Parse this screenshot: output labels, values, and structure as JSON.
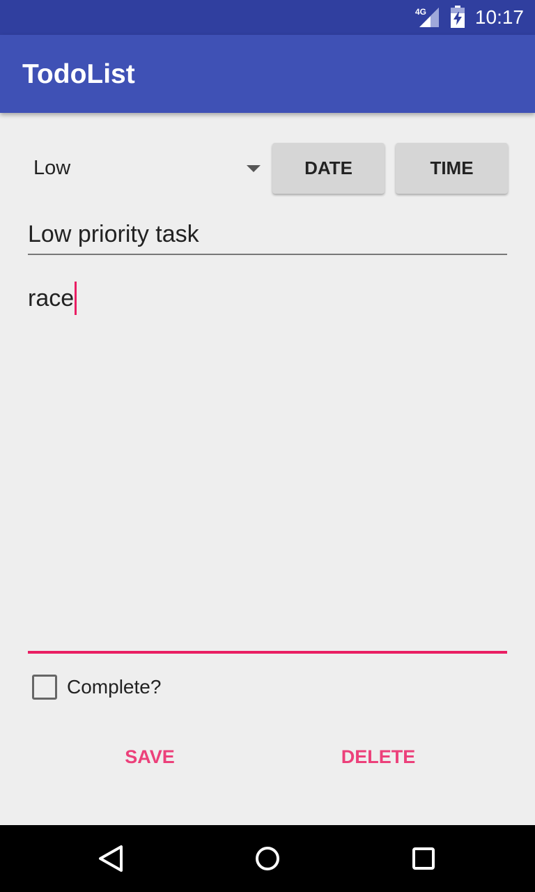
{
  "status_bar": {
    "time": "10:17",
    "network": "4G",
    "icons": [
      "signal-icon",
      "battery-charging-icon"
    ]
  },
  "app_bar": {
    "title": "TodoList"
  },
  "priority_spinner": {
    "selected": "Low",
    "icon": "dropdown-arrow-icon"
  },
  "buttons": {
    "date_label": "DATE",
    "time_label": "TIME",
    "save_label": "SAVE",
    "delete_label": "DELETE"
  },
  "title_field": {
    "value": "Low priority task"
  },
  "description_field": {
    "value": "race"
  },
  "checkbox": {
    "label": "Complete?",
    "checked": false
  },
  "nav_bar": {
    "icons": [
      "back-icon",
      "home-icon",
      "recents-icon"
    ]
  },
  "colors": {
    "status_bar": "#303f9f",
    "primary": "#3f51b5",
    "accent": "#e91e63",
    "accent_text": "#ec407a",
    "background": "#eeeeee",
    "raised_button": "#d6d6d6",
    "nav_bar": "#000000"
  }
}
